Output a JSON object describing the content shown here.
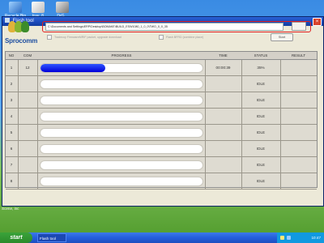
{
  "desktop": {
    "icons": [
      {
        "label": "Recycle Bin"
      },
      {
        "label": "tray_8"
      },
      {
        "label": "DrG..."
      }
    ]
  },
  "window": {
    "title": "Flash tool",
    "close_symbol": "×"
  },
  "brand": {
    "logo_text": "Sprocomm"
  },
  "controls": {
    "path_value": "C:\\Documents and Settings\\ERP\\Desktop\\BOMAKE\\BUILD_ESW1080_1_0_0\\TWO_0_0_35",
    "option1_label": "Tradecoy FirmwareMRIF packet, upgrade download",
    "option2_label": "Flash BFRD (combine place)",
    "start_label": "Start"
  },
  "table": {
    "headers": {
      "no": "NO",
      "com": "COM",
      "progress": "PROGRESS",
      "time": "TIME",
      "status": "STATUS",
      "result": "RESULT"
    },
    "rows": [
      {
        "no": "1",
        "com": "12",
        "progress": 0.4,
        "time": "00:00:39",
        "status": "35%",
        "result": ""
      },
      {
        "no": "2",
        "com": "",
        "progress": 0,
        "time": "",
        "status": "IDLE",
        "result": ""
      },
      {
        "no": "3",
        "com": "",
        "progress": 0,
        "time": "",
        "status": "IDLE",
        "result": ""
      },
      {
        "no": "4",
        "com": "",
        "progress": 0,
        "time": "",
        "status": "IDLE",
        "result": ""
      },
      {
        "no": "5",
        "com": "",
        "progress": 0,
        "time": "",
        "status": "IDLE",
        "result": ""
      },
      {
        "no": "6",
        "com": "",
        "progress": 0,
        "time": "",
        "status": "IDLE",
        "result": ""
      },
      {
        "no": "7",
        "com": "",
        "progress": 0,
        "time": "",
        "status": "IDLE",
        "result": ""
      },
      {
        "no": "8",
        "com": "",
        "progress": 0,
        "time": "",
        "status": "IDLE",
        "result": ""
      }
    ]
  },
  "desktop_text": "Scene, inc",
  "taskbar": {
    "start_label": "start",
    "task_label": "Flash tool",
    "clock": "10:47"
  }
}
